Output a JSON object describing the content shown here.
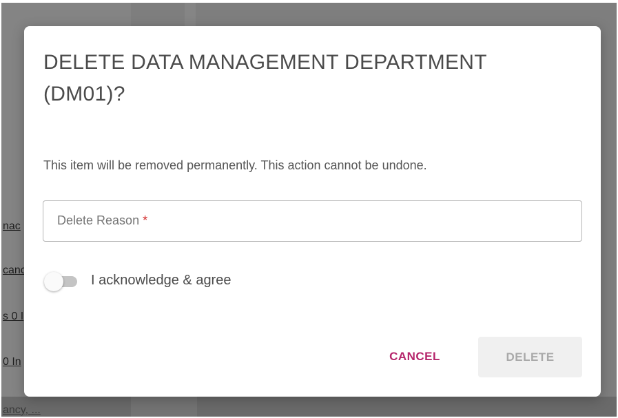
{
  "background": {
    "links": [
      "nac",
      "canc",
      "s 0 I",
      "0 In",
      "ancy, ..."
    ]
  },
  "dialog": {
    "title": "DELETE DATA MANAGEMENT DEPARTMENT (DM01)?",
    "message": "This item will be removed permanently. This action cannot be undone.",
    "reason_field": {
      "placeholder": "Delete Reason",
      "required_marker": "*",
      "value": ""
    },
    "acknowledge": {
      "label": "I acknowledge & agree",
      "checked": false
    },
    "buttons": {
      "cancel": "CANCEL",
      "delete": "DELETE"
    }
  },
  "colors": {
    "accent": "#b5256b",
    "required": "#d32f2f",
    "disabled_text": "#a9a9a9",
    "overlay": "#7e7e7e"
  }
}
